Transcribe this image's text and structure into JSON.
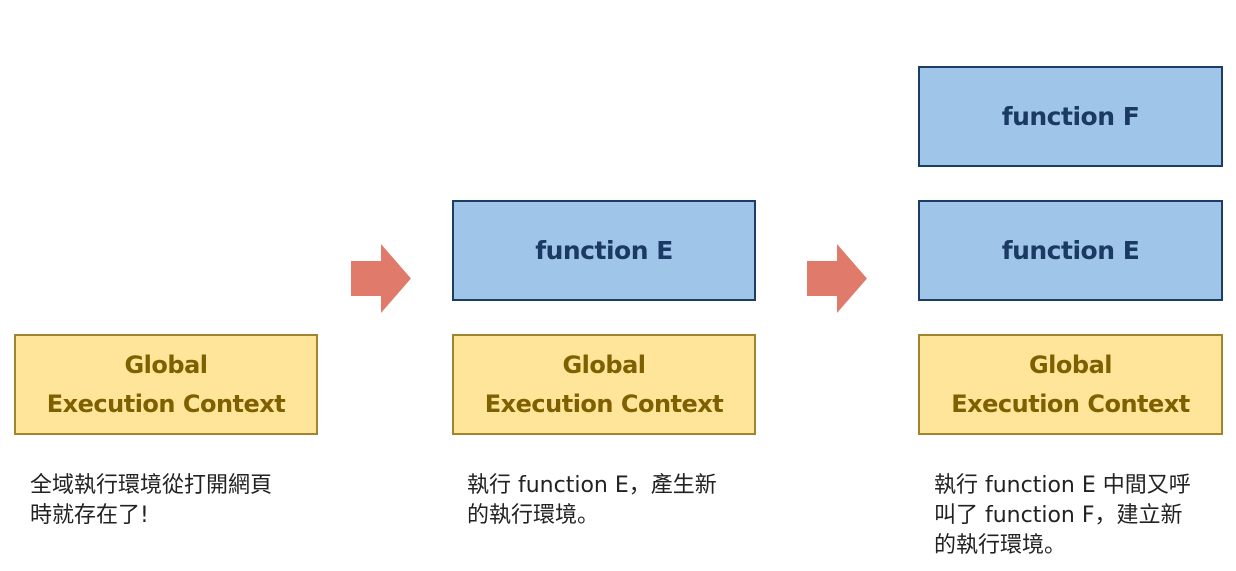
{
  "stage1": {
    "global_line1": "Global",
    "global_line2": "Execution Context",
    "caption_line1": "全域執行環境從打開網頁",
    "caption_line2": "時就存在了!"
  },
  "stage2": {
    "function_e": "function E",
    "global_line1": "Global",
    "global_line2": "Execution Context",
    "caption_line1": "執行 function E，產生新",
    "caption_line2": "的執行環境。"
  },
  "stage3": {
    "function_f": "function F",
    "function_e": "function E",
    "global_line1": "Global",
    "global_line2": "Execution Context",
    "caption_line1": "執行 function E 中間又呼",
    "caption_line2": "叫了 function F，建立新",
    "caption_line3": "的執行環境。"
  },
  "colors": {
    "global_fill": "#ffe599",
    "global_border": "#a0852e",
    "global_text": "#7f6000",
    "function_fill": "#9fc5e8",
    "function_border": "#1c3d66",
    "function_text": "#1a3a63",
    "arrow": "#e07b6b"
  },
  "icons": {
    "arrow": "right-arrow-icon"
  }
}
